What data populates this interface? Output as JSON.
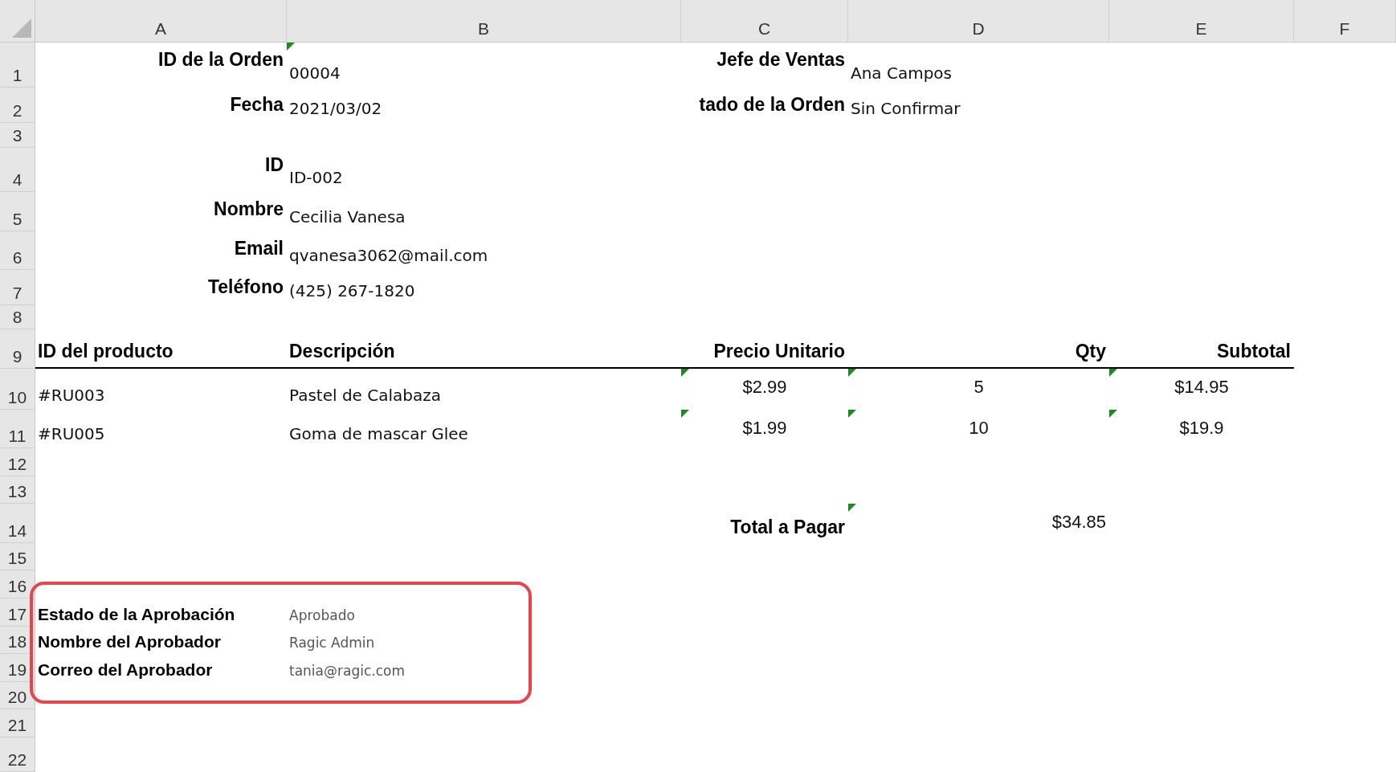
{
  "columns": [
    "A",
    "B",
    "C",
    "D",
    "E",
    "F"
  ],
  "rows": [
    {
      "number": "1",
      "cells": {
        "A": {
          "kind": "label",
          "text": "ID de la Orden"
        },
        "B": {
          "kind": "value",
          "text": "00004",
          "flagged": true
        },
        "C": {
          "kind": "label",
          "text": "Jefe de Ventas"
        },
        "D": {
          "kind": "value",
          "text": "Ana Campos"
        }
      }
    },
    {
      "number": "2",
      "cells": {
        "A": {
          "kind": "label",
          "text": "Fecha"
        },
        "B": {
          "kind": "value",
          "text": "2021/03/02"
        },
        "C": {
          "kind": "label",
          "text": "tado de la Orden"
        },
        "D": {
          "kind": "value",
          "text": "Sin Confirmar"
        }
      }
    },
    {
      "number": "3",
      "cells": {}
    },
    {
      "number": "4",
      "cells": {
        "A": {
          "kind": "label",
          "text": "ID"
        },
        "B": {
          "kind": "value",
          "text": "ID-002"
        }
      }
    },
    {
      "number": "5",
      "cells": {
        "A": {
          "kind": "label",
          "text": "Nombre"
        },
        "B": {
          "kind": "value",
          "text": "Cecilia Vanesa"
        }
      }
    },
    {
      "number": "6",
      "cells": {
        "A": {
          "kind": "label",
          "text": "Email"
        },
        "B": {
          "kind": "value",
          "text": "qvanesa3062@mail.com"
        }
      }
    },
    {
      "number": "7",
      "cells": {
        "A": {
          "kind": "label",
          "text": "Teléfono"
        },
        "B": {
          "kind": "value",
          "text": "(425) 267-1820"
        }
      }
    },
    {
      "number": "8",
      "cells": {}
    },
    {
      "number": "9",
      "underlined": true,
      "cells": {
        "A": {
          "kind": "heading",
          "text": "ID del producto"
        },
        "B": {
          "kind": "heading",
          "text": "Descripción"
        },
        "C": {
          "kind": "heading_right",
          "text": "Precio Unitario"
        },
        "D": {
          "kind": "heading_right",
          "text": "Qty"
        },
        "E": {
          "kind": "heading_right",
          "text": "Subtotal"
        }
      }
    },
    {
      "number": "10",
      "cells": {
        "A": {
          "kind": "value",
          "text": "#RU003"
        },
        "B": {
          "kind": "value",
          "text": "Pastel de Calabaza"
        },
        "C": {
          "kind": "number",
          "text": "$2.99",
          "flagged": true
        },
        "D": {
          "kind": "number",
          "text": "5",
          "flagged": true
        },
        "E": {
          "kind": "number",
          "text": "$14.95",
          "flagged": true
        }
      }
    },
    {
      "number": "11",
      "cells": {
        "A": {
          "kind": "value",
          "text": "#RU005"
        },
        "B": {
          "kind": "value",
          "text": "Goma de mascar Glee"
        },
        "C": {
          "kind": "number",
          "text": "$1.99",
          "flagged": true
        },
        "D": {
          "kind": "number",
          "text": "10",
          "flagged": true
        },
        "E": {
          "kind": "number",
          "text": "$19.9",
          "flagged": true
        }
      }
    },
    {
      "number": "12",
      "cells": {}
    },
    {
      "number": "13",
      "cells": {}
    },
    {
      "number": "14",
      "cells": {
        "C": {
          "kind": "heading_right",
          "text": "Total a Pagar"
        },
        "D": {
          "kind": "amount",
          "text": "$34.85",
          "flagged": true
        }
      }
    },
    {
      "number": "15",
      "cells": {}
    },
    {
      "number": "16",
      "cells": {}
    },
    {
      "number": "17",
      "cells": {
        "A": {
          "kind": "approval_label",
          "text": "Estado de la Aprobación"
        },
        "B": {
          "kind": "approval_value",
          "text": "Aprobado"
        }
      }
    },
    {
      "number": "18",
      "cells": {
        "A": {
          "kind": "approval_label",
          "text": "Nombre del Aprobador"
        },
        "B": {
          "kind": "approval_value",
          "text": "Ragic Admin"
        }
      }
    },
    {
      "number": "19",
      "cells": {
        "A": {
          "kind": "approval_label",
          "text": "Correo del Aprobador"
        },
        "B": {
          "kind": "approval_value",
          "text": "tania@ragic.com"
        }
      }
    },
    {
      "number": "20",
      "cells": {}
    },
    {
      "number": "21",
      "cells": {}
    },
    {
      "number": "22",
      "cells": {}
    }
  ]
}
